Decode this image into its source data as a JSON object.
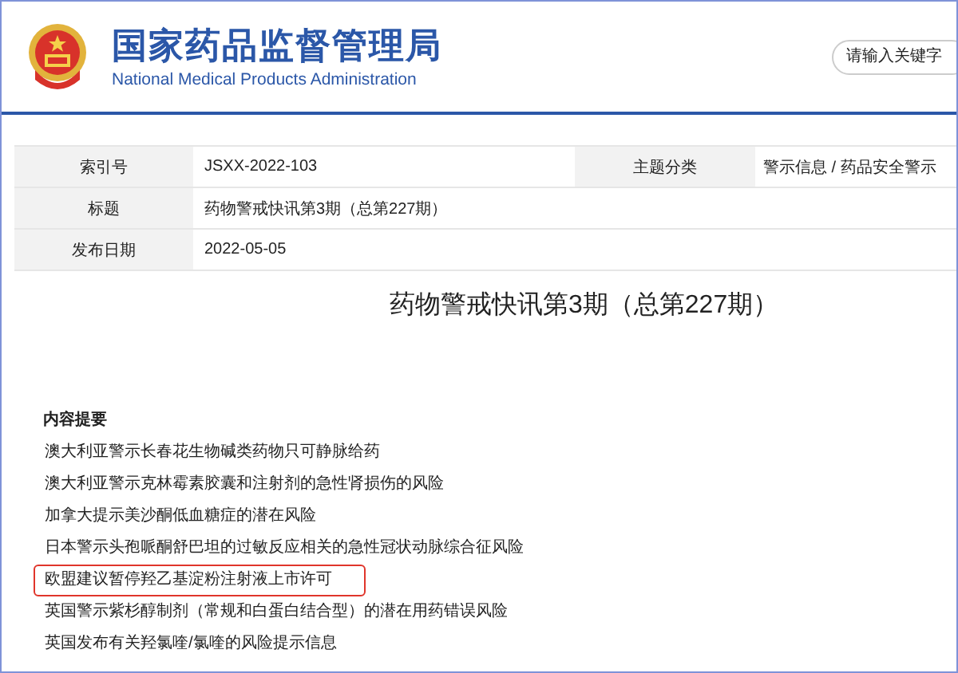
{
  "header": {
    "title": "国家药品监督管理局",
    "subtitle": "National Medical Products Administration",
    "search": {
      "placeholder": "请输入关键字"
    }
  },
  "info_table": [
    {
      "label": "索引号",
      "value": "JSXX-2022-103",
      "label_2": "主题分类",
      "value_2": "警示信息 / 药品安全警示"
    },
    {
      "label": "标题",
      "value": "药物警戒快讯第3期（总第227期）"
    },
    {
      "label": "发布日期",
      "value": "2022-05-05"
    }
  ],
  "article": {
    "title": "药物警戒快讯第3期（总第227期）",
    "summary_heading": "内容提要",
    "summary_items": [
      {
        "text": "澳大利亚警示长春花生物碱类药物只可静脉给药",
        "highlighted": false
      },
      {
        "text": "澳大利亚警示克林霉素胶囊和注射剂的急性肾损伤的风险",
        "highlighted": false
      },
      {
        "text": "加拿大提示美沙酮低血糖症的潜在风险",
        "highlighted": false
      },
      {
        "text": "日本警示头孢哌酮舒巴坦的过敏反应相关的急性冠状动脉综合征风险",
        "highlighted": false
      },
      {
        "text": "欧盟建议暂停羟乙基淀粉注射液上市许可",
        "highlighted": true
      },
      {
        "text": "英国警示紫杉醇制剂（常规和白蛋白结合型）的潜在用药错误风险",
        "highlighted": false
      },
      {
        "text": "英国发布有关羟氯喹/氯喹的风险提示信息",
        "highlighted": false
      }
    ]
  }
}
